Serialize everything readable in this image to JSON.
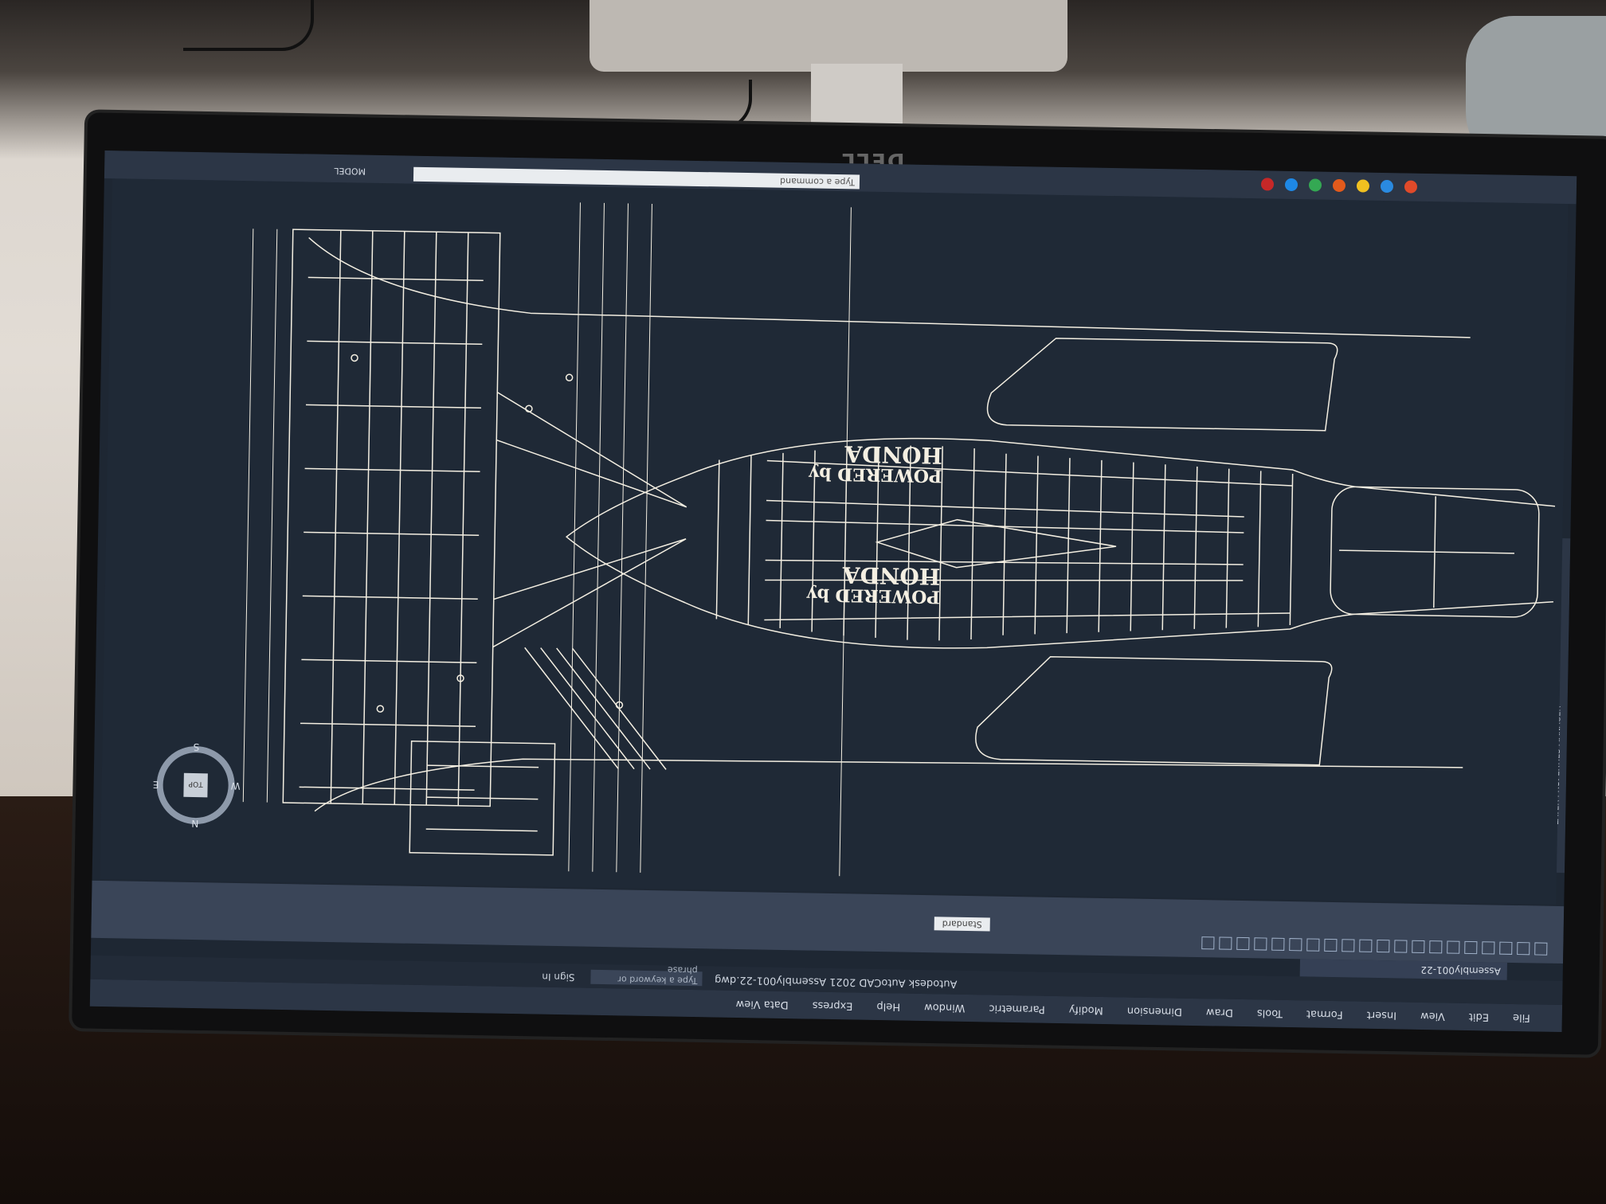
{
  "app": {
    "title": "Autodesk AutoCAD 2021   Assembly001-22.dwg",
    "search_placeholder": "Type a keyword or phrase",
    "sign_in": "Sign In",
    "document_tab": "Assembly001-22",
    "command_placeholder": "Type a command",
    "model_label": "MODEL",
    "layer_palette_label": "LAYER PROPERTIES MANAGER",
    "standard_label": "Standard",
    "view_label": "TOP"
  },
  "ribbon_tabs": [
    "File",
    "Edit",
    "View",
    "Insert",
    "Format",
    "Tools",
    "Draw",
    "Dimension",
    "Modify",
    "Parametric",
    "Window",
    "Help",
    "Express",
    "Data View"
  ],
  "compass": {
    "north": "N",
    "south": "S",
    "east": "E",
    "west": "W"
  },
  "drawing_text": {
    "sponsor_top": "HONDA",
    "sponsor_top_sub": "POWERED by",
    "sponsor_bottom_sub": "POWERED by",
    "sponsor_bottom": "HONDA"
  },
  "monitor_brand": "DELL",
  "colors": {
    "ui_dark": "#2c3646",
    "canvas": "#1f2936",
    "line": "#f4efe2"
  }
}
